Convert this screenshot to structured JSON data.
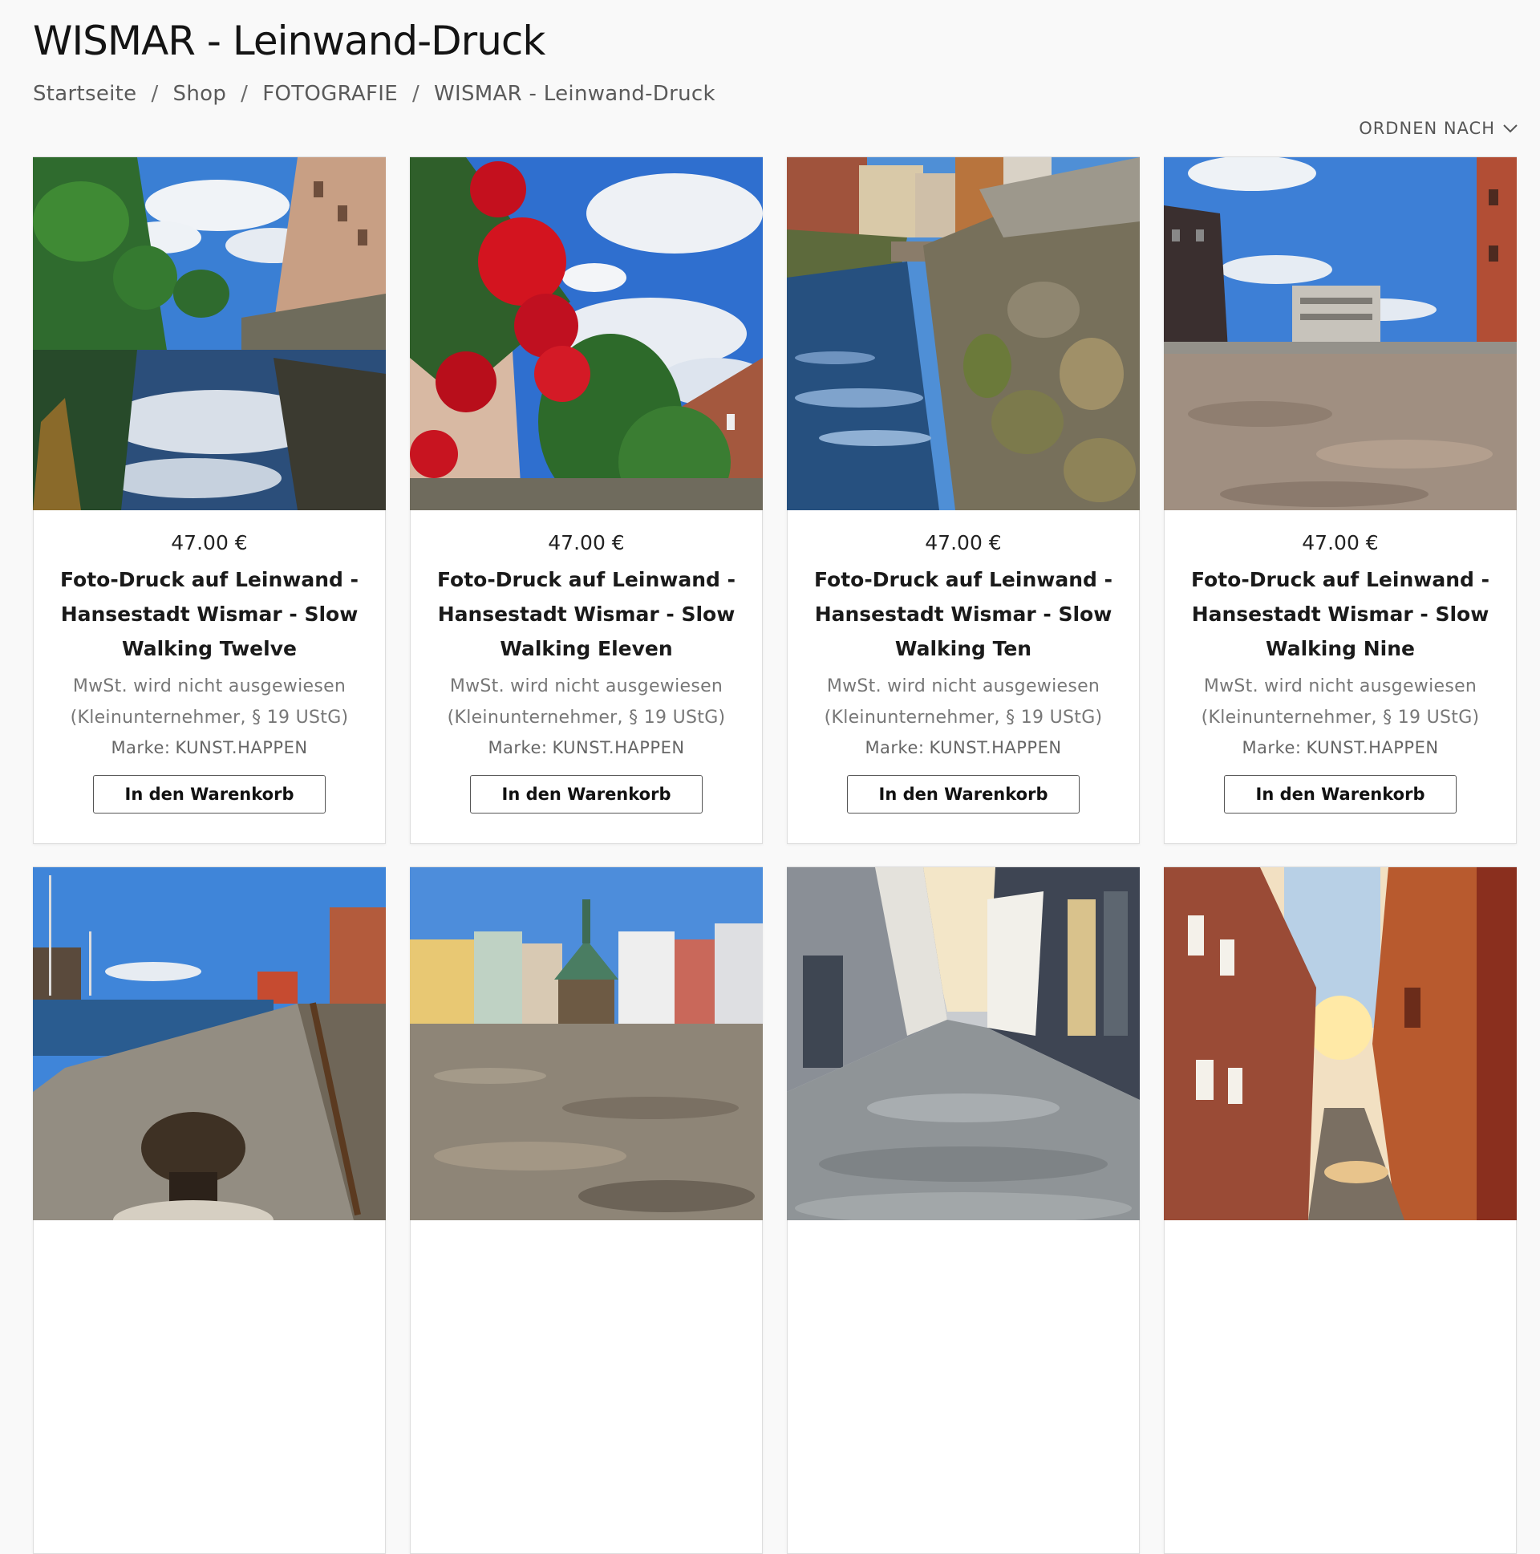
{
  "page": {
    "title": "WISMAR - Leinwand-Druck"
  },
  "breadcrumb": [
    {
      "label": "Startseite"
    },
    {
      "label": "Shop"
    },
    {
      "label": "FOTOGRAFIE"
    },
    {
      "label": "WISMAR - Leinwand-Druck"
    }
  ],
  "breadcrumb_separator": "/",
  "sort": {
    "label": "ORDNEN NACH"
  },
  "products": [
    {
      "price": "47.00 €",
      "name": "Foto-Druck auf Leinwand - Hansestadt Wismar - Slow Walking Twelve",
      "tax_note": "MwSt. wird nicht ausgewiesen (Kleinunternehmer, § 19 UStG)",
      "brand_label": "Marke:",
      "brand": "KUNST.HAPPEN",
      "button": "In den Warenkorb"
    },
    {
      "price": "47.00 €",
      "name": "Foto-Druck auf Leinwand - Hansestadt Wismar - Slow Walking Eleven",
      "tax_note": "MwSt. wird nicht ausgewiesen (Kleinunternehmer, § 19 UStG)",
      "brand_label": "Marke:",
      "brand": "KUNST.HAPPEN",
      "button": "In den Warenkorb"
    },
    {
      "price": "47.00 €",
      "name": "Foto-Druck auf Leinwand - Hansestadt Wismar - Slow Walking Ten",
      "tax_note": "MwSt. wird nicht ausgewiesen (Kleinunternehmer, § 19 UStG)",
      "brand_label": "Marke:",
      "brand": "KUNST.HAPPEN",
      "button": "In den Warenkorb"
    },
    {
      "price": "47.00 €",
      "name": "Foto-Druck auf Leinwand - Hansestadt Wismar - Slow Walking Nine",
      "tax_note": "MwSt. wird nicht ausgewiesen (Kleinunternehmer, § 19 UStG)",
      "brand_label": "Marke:",
      "brand": "KUNST.HAPPEN",
      "button": "In den Warenkorb"
    }
  ]
}
